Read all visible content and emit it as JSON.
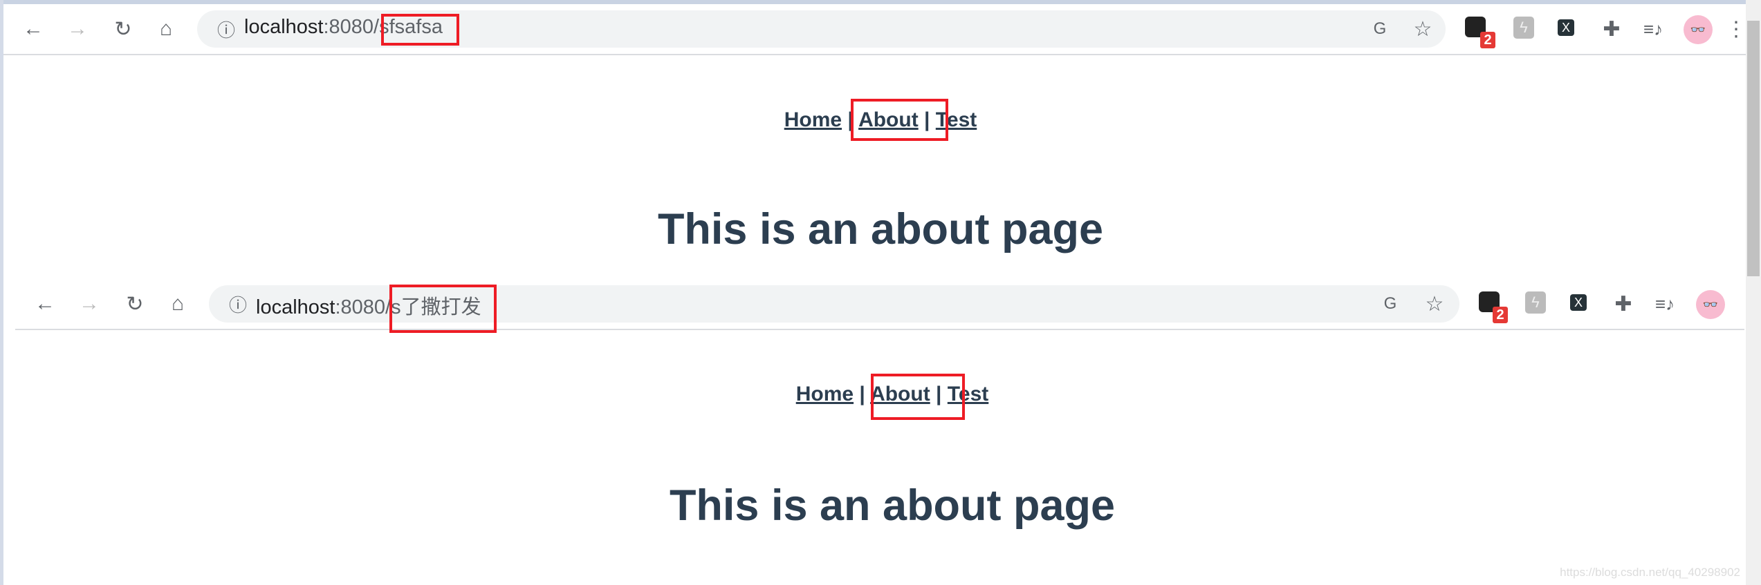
{
  "windows": [
    {
      "url_host": "localhost",
      "url_port": ":8080/",
      "url_path": "sfsafsa",
      "nav": [
        "Home",
        "About",
        "Test"
      ],
      "separator": "|",
      "heading": "This is an about page",
      "extension_badge": "2"
    },
    {
      "url_host": "localhost",
      "url_port": ":8080/",
      "url_path": "s了撒打发",
      "nav": [
        "Home",
        "About",
        "Test"
      ],
      "separator": "|",
      "heading": "This is an about page",
      "extension_badge": "2"
    }
  ],
  "watermark": "https://blog.csdn.net/qq_40298902",
  "colors": {
    "highlight": "#ee1c25",
    "text": "#2c3e50",
    "avatar": "#f8bbd0"
  }
}
